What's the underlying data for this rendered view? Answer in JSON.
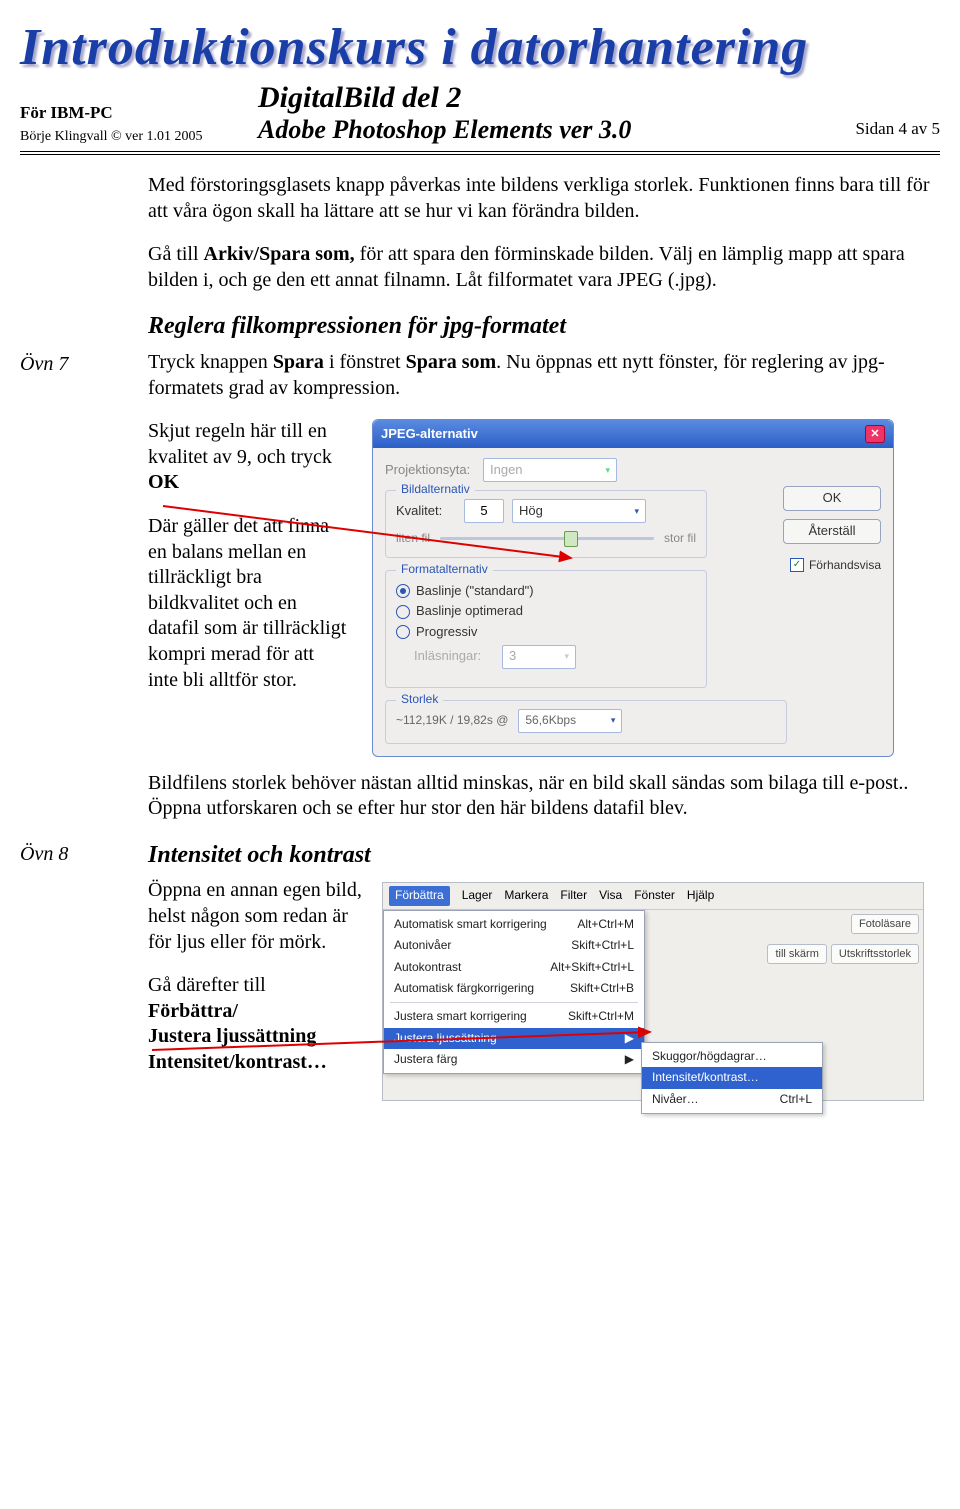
{
  "banner": "Introduktionskurs i datorhantering",
  "header": {
    "left_line1": "För IBM-PC",
    "left_line2": "Börje Klingvall © ver 1.01  2005",
    "title1": "DigitalBild del 2",
    "title2": "Adobe Photoshop Elements ver 3.0",
    "page": "Sidan 4 av 5"
  },
  "p1": "Med förstoringsglasets knapp påverkas inte bildens verkliga storlek. Funktionen finns bara till för att våra ögon skall ha lättare att se hur vi kan förändra bilden.",
  "p2a": "Gå till ",
  "p2b": "Arkiv/Spara som,",
  "p2c": " för att spara den förminskade bilden. Välj en lämplig mapp att spara bilden i, och ge den ett annat filnamn. Låt filformatet vara JPEG (.jpg).",
  "h_jpg": "Reglera filkompressionen för jpg-formatet",
  "ovn7": "Övn 7",
  "p3a": "Tryck knappen ",
  "p3b": "Spara",
  "p3c": "  i fönstret ",
  "p3d": "Spara som",
  "p3e": ". Nu öppnas ett nytt fönster, för reglering av jpg-formatets grad av kompression.",
  "p4a": "Skjut regeln här till en kvalitet av 9, och tryck ",
  "p4b": "OK",
  "p5": "Där gäller det att finna en balans mellan en tillräckligt bra bildkvalitet och en datafil som är tillräckligt kompri merad för att inte  bli alltför stor.",
  "p6": "Bildfilens storlek behöver nästan alltid minskas, när en bild skall sändas som bilaga till e-post.. Öppna utforskaren och se efter hur stor den här bildens datafil blev.",
  "h_int": "Intensitet och kontrast",
  "ovn8": "Övn 8",
  "p7": "Öppna en annan egen bild, helst någon som redan är för ljus eller för mörk.",
  "p8a": "Gå därefter till",
  "p8b": "Förbättra/",
  "p8c": "Justera ljussättning",
  "p8d": "Intensitet/kontrast…",
  "jpeg": {
    "title": "JPEG-alternativ",
    "proj_label": "Projektionsyta:",
    "proj_value": "Ingen",
    "grp_bild": "Bildalternativ",
    "qual_label": "Kvalitet:",
    "qual_num": "5",
    "qual_level": "Hög",
    "small": "liten fil",
    "big": "stor fil",
    "grp_format": "Formatalternativ",
    "opt1": "Baslinje (\"standard\")",
    "opt2": "Baslinje optimerad",
    "opt3": "Progressiv",
    "inlas_label": "Inläsningar:",
    "inlas_val": "3",
    "grp_size": "Storlek",
    "size_text": "~112,19K / 19,82s  @",
    "size_rate": "56,6Kbps",
    "ok": "OK",
    "reset": "Återställ",
    "preview": "Förhandsvisa"
  },
  "menu": {
    "top": [
      "Förbättra",
      "Lager",
      "Markera",
      "Filter",
      "Visa",
      "Fönster",
      "Hjälp"
    ],
    "items": [
      {
        "l": "Automatisk smart korrigering",
        "r": "Alt+Ctrl+M"
      },
      {
        "l": "Autonivåer",
        "r": "Skift+Ctrl+L"
      },
      {
        "l": "Autokontrast",
        "r": "Alt+Skift+Ctrl+L"
      },
      {
        "l": "Automatisk färgkorrigering",
        "r": "Skift+Ctrl+B"
      }
    ],
    "items2": [
      {
        "l": "Justera smart korrigering",
        "r": "Skift+Ctrl+M"
      },
      {
        "l": "Justera ljussättning",
        "r": "▶"
      },
      {
        "l": "Justera färg",
        "r": "▶"
      }
    ],
    "sub": [
      {
        "l": "Skuggor/högdagrar…",
        "r": ""
      },
      {
        "l": "Intensitet/kontrast…",
        "r": ""
      },
      {
        "l": "Nivåer…",
        "r": "Ctrl+L"
      }
    ],
    "pill_foto": "Fotoläsare",
    "pill_skarm": "till skärm",
    "pill_utskrift": "Utskriftsstorlek"
  }
}
